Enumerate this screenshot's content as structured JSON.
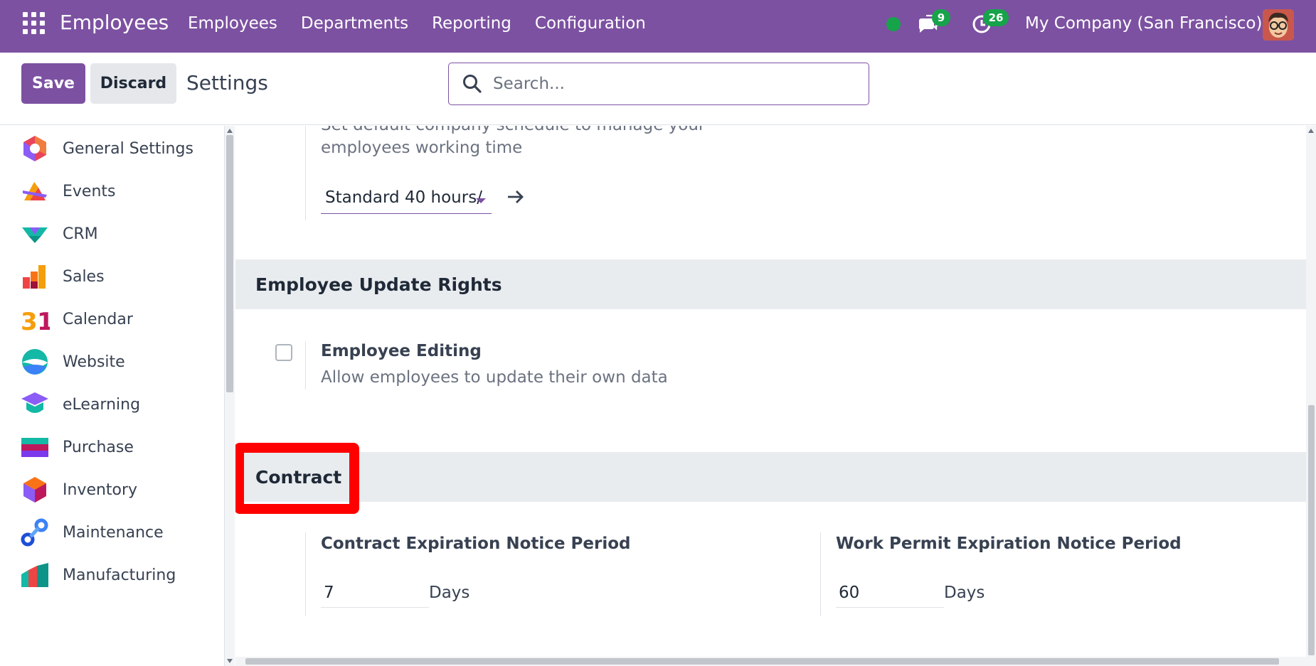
{
  "navbar": {
    "app_title": "Employees",
    "menu": [
      "Employees",
      "Departments",
      "Reporting",
      "Configuration"
    ],
    "chat_count": "9",
    "activity_count": "26",
    "company": "My Company (San Francisco)",
    "brand_color": "#7c51a1"
  },
  "control_panel": {
    "save_label": "Save",
    "discard_label": "Discard",
    "title": "Settings",
    "search_placeholder": "Search..."
  },
  "sidebar": {
    "items": [
      {
        "label": "General Settings",
        "icon": "general-settings-icon"
      },
      {
        "label": "Events",
        "icon": "events-icon"
      },
      {
        "label": "CRM",
        "icon": "crm-icon"
      },
      {
        "label": "Sales",
        "icon": "sales-icon"
      },
      {
        "label": "Calendar",
        "icon": "calendar-icon"
      },
      {
        "label": "Website",
        "icon": "website-icon"
      },
      {
        "label": "eLearning",
        "icon": "elearning-icon"
      },
      {
        "label": "Purchase",
        "icon": "purchase-icon"
      },
      {
        "label": "Inventory",
        "icon": "inventory-icon"
      },
      {
        "label": "Maintenance",
        "icon": "maintenance-icon"
      },
      {
        "label": "Manufacturing",
        "icon": "manufacturing-icon"
      }
    ]
  },
  "main": {
    "work_schedule": {
      "desc_line1": "Set default company schedule to manage your",
      "desc_line2": "employees working time",
      "selected": "Standard 40 hours/"
    },
    "update_rights": {
      "title": "Employee Update Rights",
      "label": "Employee Editing",
      "desc": "Allow employees to update their own data",
      "checked": false
    },
    "contract": {
      "title": "Contract",
      "contract_label": "Contract Expiration Notice Period",
      "contract_value": "7",
      "contract_unit": "Days",
      "permit_label": "Work Permit Expiration Notice Period",
      "permit_value": "60",
      "permit_unit": "Days"
    }
  }
}
